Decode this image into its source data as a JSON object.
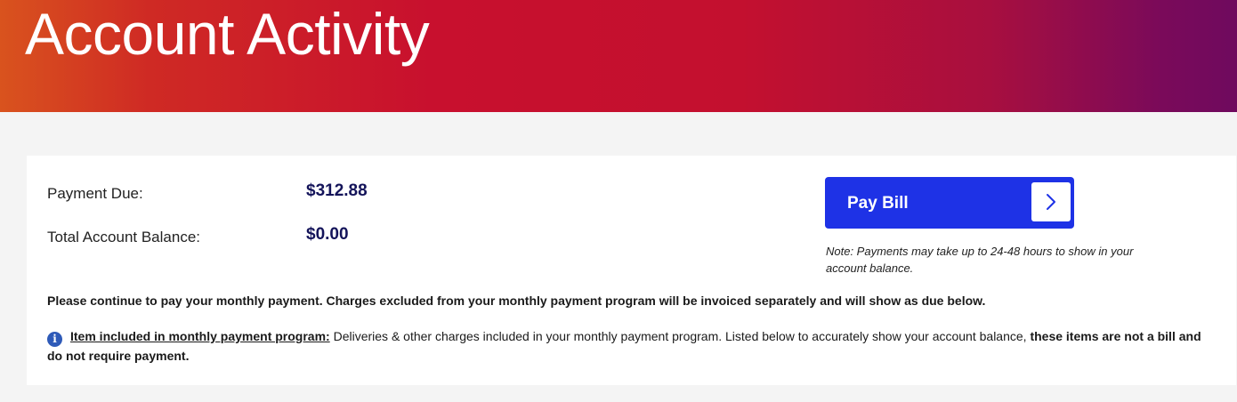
{
  "header": {
    "title": "Account Activity"
  },
  "summary": {
    "payment_due_label": "Payment Due:",
    "payment_due_value": "$312.88",
    "balance_label": "Total Account Balance:",
    "balance_value": "$0.00"
  },
  "pay_bill": {
    "label": "Pay Bill",
    "icon": "chevron-right-icon",
    "note": "Note: Payments may take up to 24-48 hours to show in your account balance."
  },
  "messages": {
    "continue": "Please continue to pay your monthly payment. Charges excluded from your monthly payment program will be invoiced separately and will show as due below.",
    "info_icon": "info-icon",
    "info_link": "Item included in monthly payment program:",
    "info_text": " Deliveries & other charges included in your monthly payment program. Listed below to accurately show your account balance, ",
    "info_bold": "these items are not a bill and do not require payment."
  },
  "colors": {
    "header_gradient_start": "#d9531e",
    "header_gradient_mid": "#c8102e",
    "header_gradient_end": "#6f0a5e",
    "pay_button": "#1e32e6",
    "amount_text": "#14145a",
    "info_icon": "#2e5ab8",
    "page_background": "#f4f4f4"
  }
}
